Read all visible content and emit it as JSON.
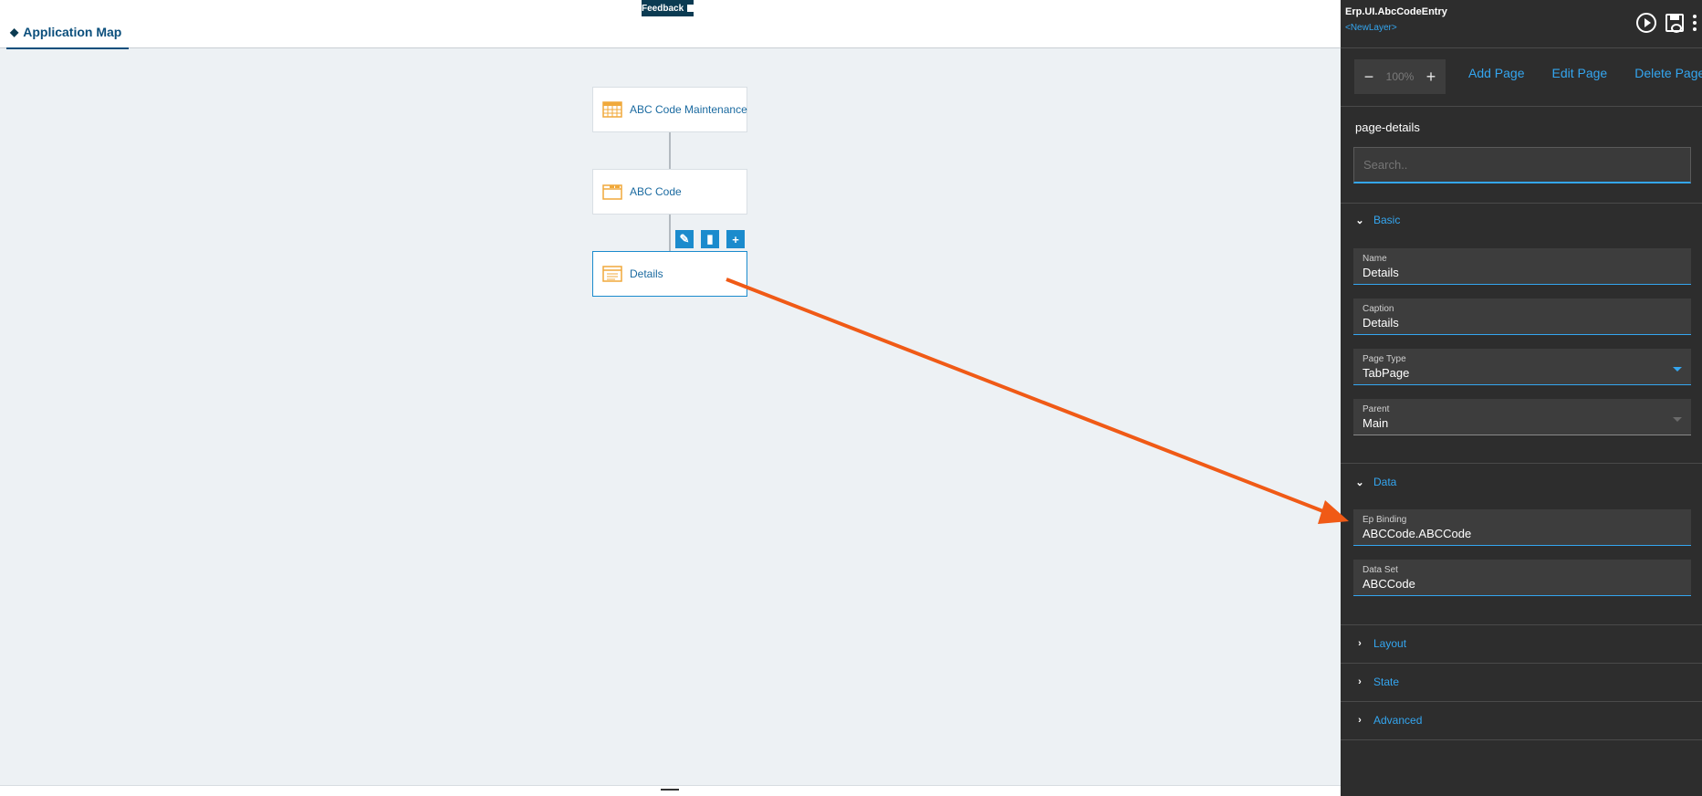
{
  "header": {
    "feedback_label": "Feedback",
    "tab_label": "Application Map"
  },
  "map": {
    "nodes": [
      {
        "label": "ABC Code Maintenance",
        "icon": "grid-icon"
      },
      {
        "label": "ABC Code",
        "icon": "folder-icon"
      },
      {
        "label": "Details",
        "icon": "page-icon"
      }
    ],
    "actions": [
      "edit-icon",
      "trash-icon",
      "plus-icon"
    ]
  },
  "panel": {
    "title": "Erp.UI.AbcCodeEntry",
    "layer": "<NewLayer>",
    "zoom": {
      "minus": "−",
      "value": "100%",
      "plus": "+"
    },
    "page_actions": {
      "add": "Add Page",
      "edit": "Edit Page",
      "delete": "Delete Page"
    },
    "section_name": "page-details",
    "search_placeholder": "Search..",
    "groups": {
      "basic": "Basic",
      "data": "Data",
      "layout": "Layout",
      "state": "State",
      "advanced": "Advanced"
    },
    "fields": {
      "name": {
        "label": "Name",
        "value": "Details"
      },
      "caption": {
        "label": "Caption",
        "value": "Details"
      },
      "page_type": {
        "label": "Page Type",
        "value": "TabPage"
      },
      "parent": {
        "label": "Parent",
        "value": "Main"
      },
      "ep_binding": {
        "label": "Ep Binding",
        "value": "ABCCode.ABCCode"
      },
      "data_set": {
        "label": "Data Set",
        "value": "ABCCode"
      }
    }
  },
  "colors": {
    "accent": "#34a6f0",
    "panel_bg": "#2d2d2d",
    "node_link": "#1a6aa0",
    "annotation_arrow": "#f05a16",
    "node_icon": "#f0a93b"
  }
}
